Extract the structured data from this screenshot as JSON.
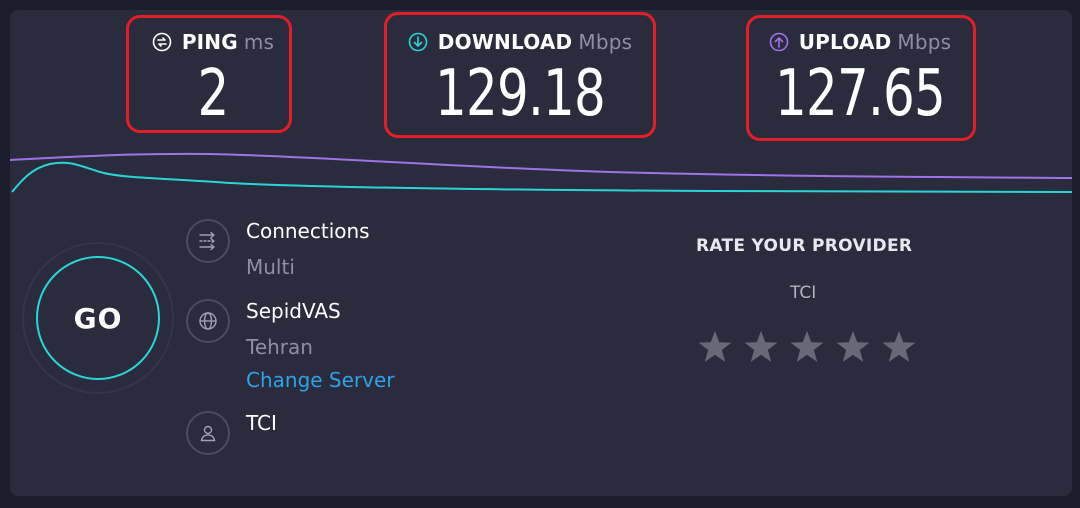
{
  "ping": {
    "label": "PING",
    "unit": "ms",
    "value": "2",
    "icon": "ping-icon"
  },
  "download": {
    "label": "DOWNLOAD",
    "unit": "Mbps",
    "value": "129.18",
    "icon": "download-arrow-icon"
  },
  "upload": {
    "label": "UPLOAD",
    "unit": "Mbps",
    "value": "127.65",
    "icon": "upload-arrow-icon"
  },
  "go_button": {
    "label": "GO"
  },
  "connections": {
    "title": "Connections",
    "value": "Multi",
    "icon": "connections-icon"
  },
  "server": {
    "name": "SepidVAS",
    "location": "Tehran",
    "change_label": "Change Server",
    "icon": "globe-icon"
  },
  "isp": {
    "name": "TCI",
    "icon": "user-icon"
  },
  "rating": {
    "title": "RATE YOUR PROVIDER",
    "provider": "TCI",
    "stars": 5,
    "rating": 0
  },
  "colors": {
    "highlight": "#e41e26",
    "download_accent": "#28d6d6",
    "upload_accent": "#a071e8",
    "link": "#2fa2e8",
    "panel_bg": "#2a2b3d",
    "page_bg": "#1c1d2c"
  }
}
